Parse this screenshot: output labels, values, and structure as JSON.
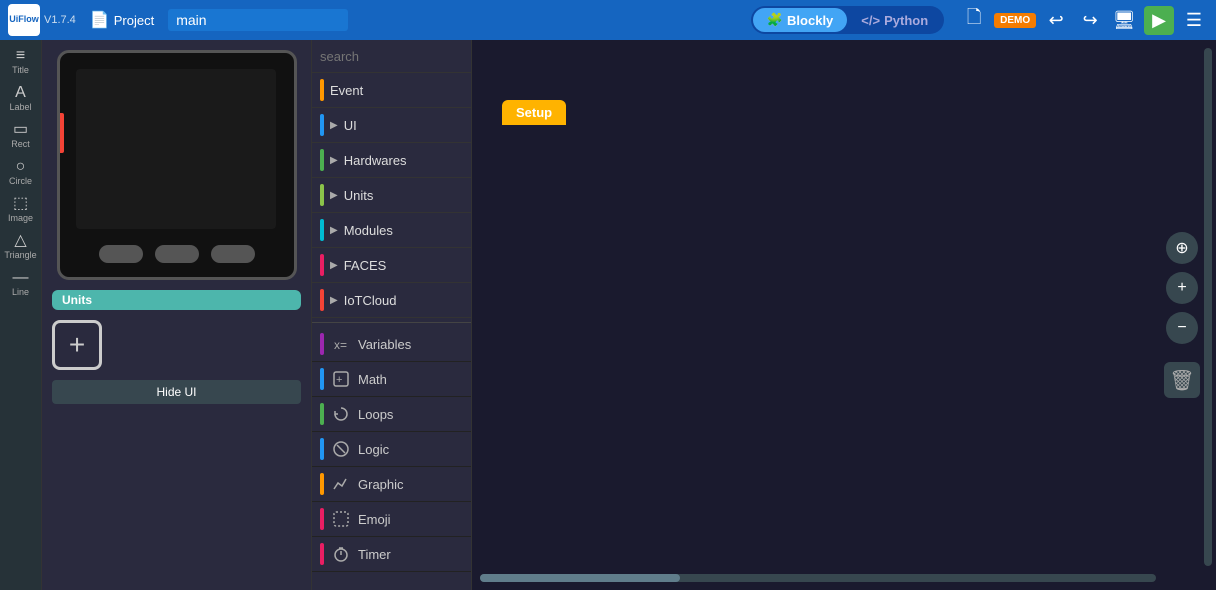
{
  "topbar": {
    "logo_line1": "Ui",
    "logo_line2": "Flow",
    "version": "V1.7.4",
    "project_label": "Project",
    "filename": "main",
    "mode_blockly": "Blockly",
    "mode_python": "Python",
    "demo_badge": "DEMO",
    "run_icon": "▶"
  },
  "sidebar_tools": [
    {
      "name": "title-tool",
      "icon": "☰",
      "label": "Title"
    },
    {
      "name": "label-tool",
      "icon": "🏷",
      "label": "Label"
    },
    {
      "name": "rect-tool",
      "icon": "⬜",
      "label": "Rect"
    },
    {
      "name": "circle-tool",
      "icon": "⭕",
      "label": "Circle"
    },
    {
      "name": "image-tool",
      "icon": "🖼",
      "label": "Image"
    },
    {
      "name": "triangle-tool",
      "icon": "△",
      "label": "Triangle"
    },
    {
      "name": "line-tool",
      "icon": "—",
      "label": "Line"
    }
  ],
  "device": {
    "units_label": "Units",
    "add_btn_icon": "+",
    "hide_ui_btn": "Hide UI"
  },
  "blocks": {
    "search_placeholder": "search",
    "categories": [
      {
        "name": "event",
        "label": "Event",
        "color": "#ff9800",
        "arrow": false
      },
      {
        "name": "ui",
        "label": "UI",
        "color": "#2196f3",
        "arrow": true
      },
      {
        "name": "hardwares",
        "label": "Hardwares",
        "color": "#4caf50",
        "arrow": true
      },
      {
        "name": "units",
        "label": "Units",
        "color": "#8bc34a",
        "arrow": true
      },
      {
        "name": "modules",
        "label": "Modules",
        "color": "#00bcd4",
        "arrow": true
      },
      {
        "name": "faces",
        "label": "FACES",
        "color": "#e91e63",
        "arrow": true
      },
      {
        "name": "iotcloud",
        "label": "IoTCloud",
        "color": "#f44336",
        "arrow": true
      }
    ],
    "sub_categories": [
      {
        "name": "variables",
        "label": "Variables",
        "color": "#9c27b0",
        "icon": "𝑥"
      },
      {
        "name": "math",
        "label": "Math",
        "color": "#2196f3",
        "icon": "⊞"
      },
      {
        "name": "loops",
        "label": "Loops",
        "color": "#4caf50",
        "icon": "↺"
      },
      {
        "name": "logic",
        "label": "Logic",
        "color": "#2196f3",
        "icon": "⊗"
      },
      {
        "name": "graphic",
        "label": "Graphic",
        "color": "#ff9800",
        "icon": "📈"
      },
      {
        "name": "emoji",
        "label": "Emoji",
        "color": "#e91e63",
        "icon": "😊"
      },
      {
        "name": "timer",
        "label": "Timer",
        "color": "#e91e63",
        "icon": "⏱"
      }
    ]
  },
  "canvas": {
    "setup_block_label": "Setup"
  }
}
